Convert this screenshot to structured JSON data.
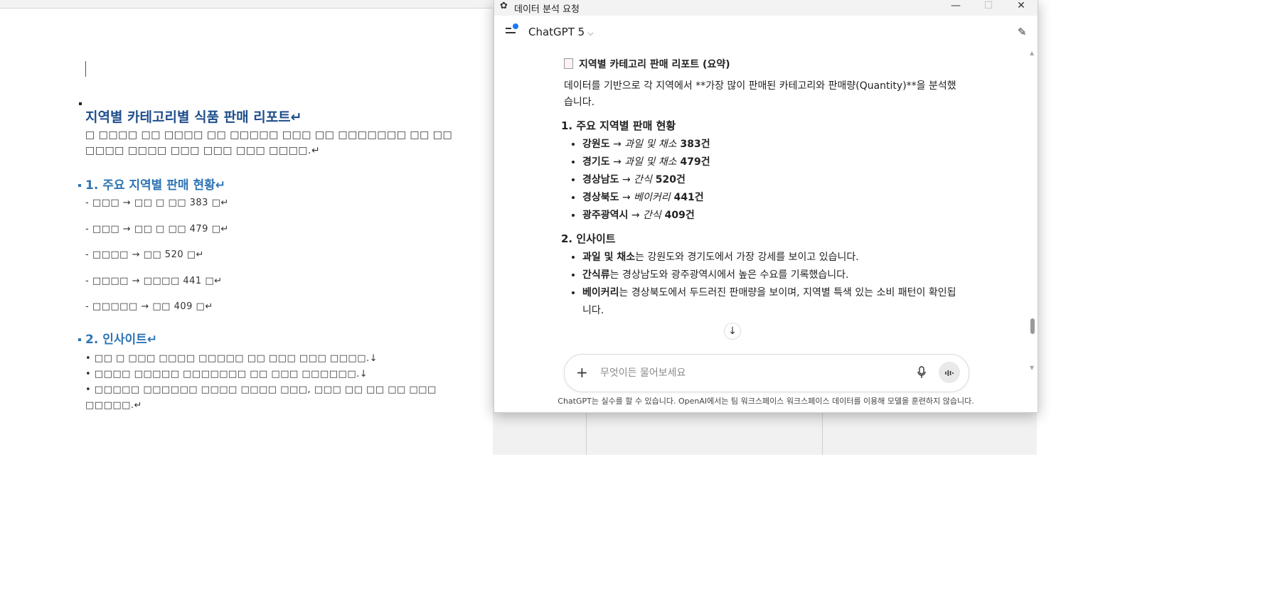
{
  "document": {
    "title": "지역별 카테고리별 식품 판매 리포트↵",
    "intro_line1": "□ □□□□ □□ □□□□ □□ □□□□□ □□□ □□ □□□□□□□ □□ □□",
    "intro_line2": "□□□□ □□□□ □□□ □□□ □□□ □□□□.↵",
    "section1_heading": "1. 주요 지역별 판매 현황↵",
    "section1_lines": [
      "- □□□ → □□ □ □□ 383 □↵",
      "- □□□ → □□ □ □□ 479 □↵",
      "- □□□□ → □□ 520 □↵",
      "- □□□□ → □□□□ 441 □↵",
      "- □□□□□ → □□ 409 □↵"
    ],
    "section2_heading": "2. 인사이트↵",
    "section2_lines": [
      "• □□ □ □□□ □□□□ □□□□□ □□ □□□ □□□ □□□□.↓",
      "• □□□□ □□□□□ □□□□□□□ □□ □□□ □□□□□□.↓",
      "• □□□□□ □□□□□□ □□□□ □□□□ □□□, □□□ □□ □□ □□ □□□",
      "□□□□□.↵"
    ]
  },
  "chat_window": {
    "window_title": "데이터 분석 요청",
    "minimize": "—",
    "maximize": "☐",
    "close": "✕",
    "model_name": "ChatGPT 5",
    "report_title": "지역별 카테고리 판매 리포트 (요약)",
    "intro": "데이터를 기반으로 각 지역에서 **가장 많이 판매된 카테고리와 판매량(Quantity)**을 분석했습니다.",
    "section1_heading": "1. 주요 지역별 판매 현황",
    "section1_items": [
      {
        "region": "강원도",
        "arrow": " → ",
        "category": "과일 및 채소",
        "count": " 383건"
      },
      {
        "region": "경기도",
        "arrow": " → ",
        "category": "과일 및 채소",
        "count": " 479건"
      },
      {
        "region": "경상남도",
        "arrow": " → ",
        "category": "간식",
        "count": " 520건"
      },
      {
        "region": "경상북도",
        "arrow": " → ",
        "category": "베이커리",
        "count": " 441건"
      },
      {
        "region": "광주광역시",
        "arrow": " → ",
        "category": "간식",
        "count": " 409건"
      }
    ],
    "section2_heading": "2. 인사이트",
    "section2_items": [
      {
        "bold": "과일 및 채소",
        "rest": "는 강원도와 경기도에서 가장 강세를 보이고 있습니다."
      },
      {
        "bold": "간식류",
        "rest": "는 경상남도와 광주광역시에서 높은 수요를 기록했습니다."
      },
      {
        "bold": "베이커리",
        "rest": "는 경상북도에서 두드러진 판매량을 보이며, 지역별 특색 있는 소비 패턴이 확인됩니다."
      }
    ],
    "composer_placeholder": "무엇이든 물어보세요",
    "disclaimer": "ChatGPT는 실수를 할 수 있습니다. OpenAI에서는 팀 워크스페이스 워크스페이스 데이터를 이용해 모델을 훈련하지 않습니다."
  }
}
